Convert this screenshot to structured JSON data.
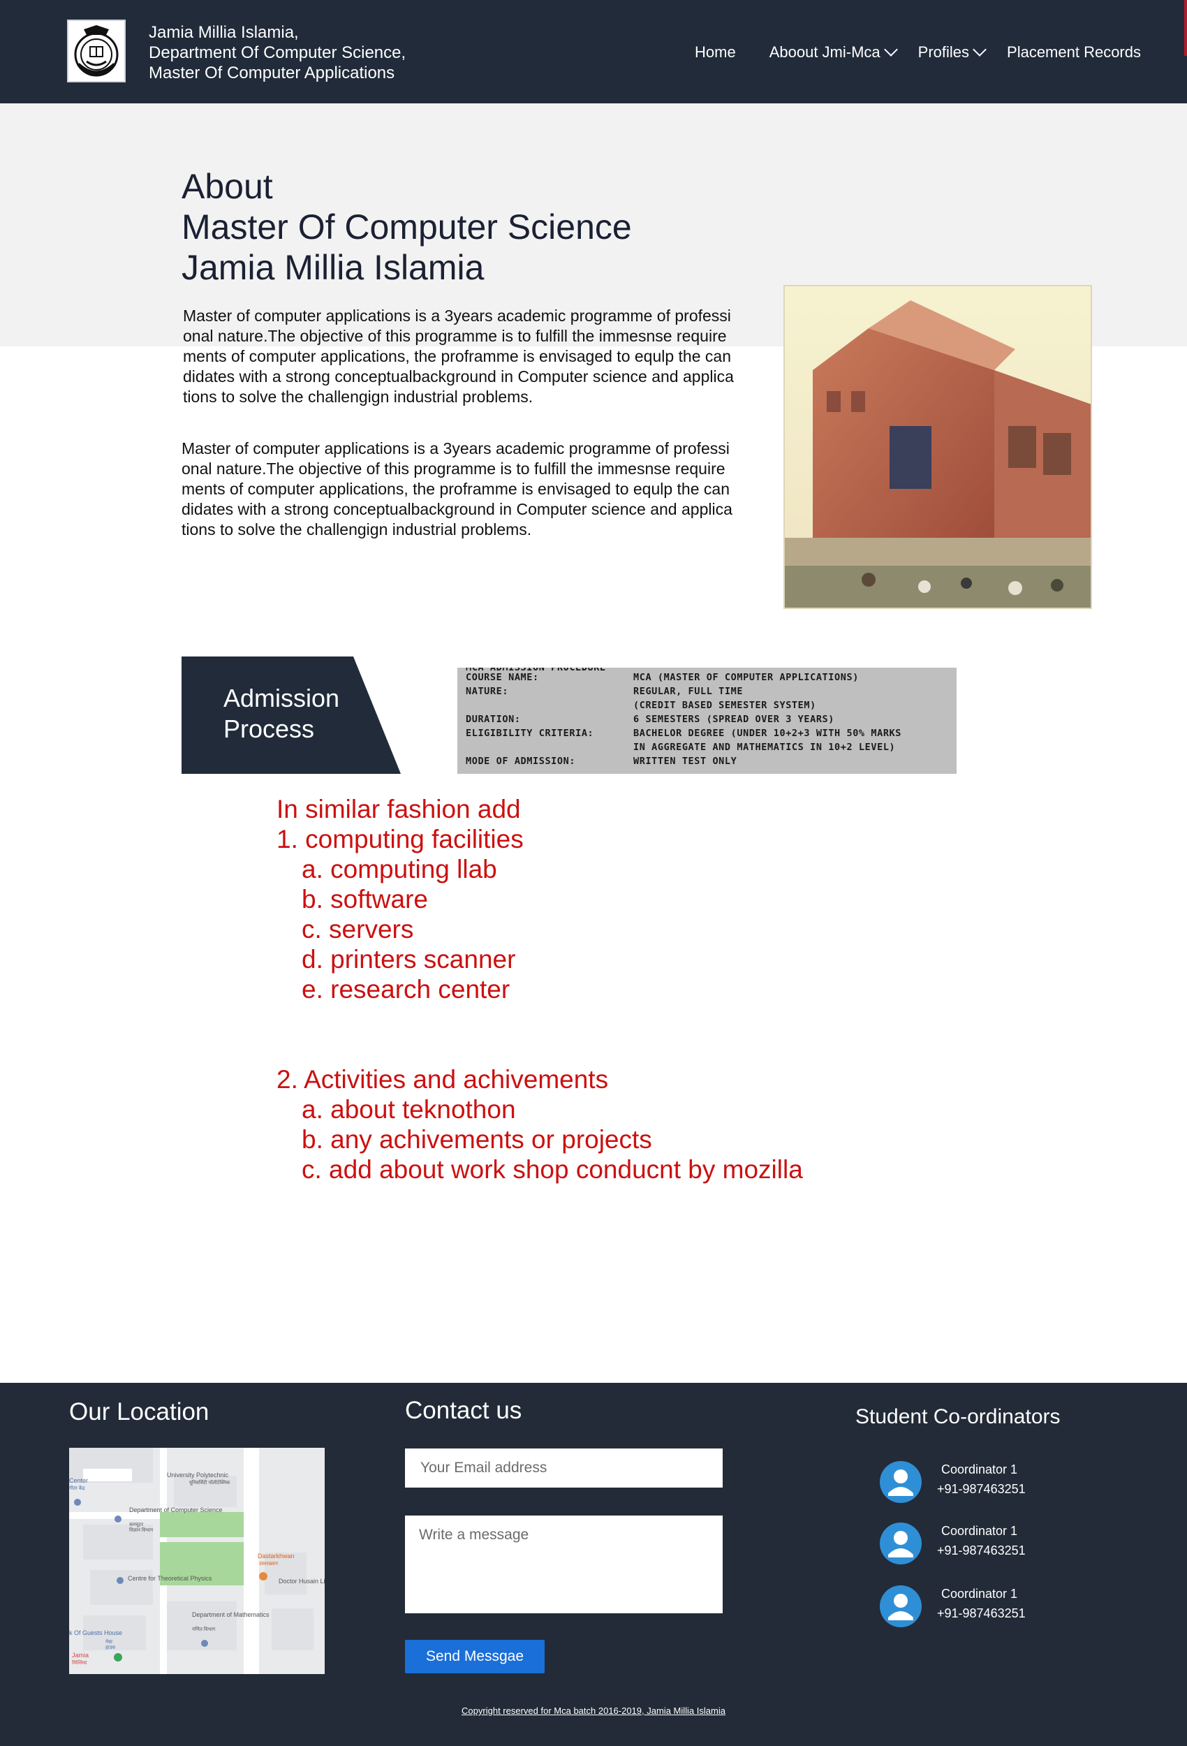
{
  "header": {
    "brand_line1": "Jamia Millia Islamia,",
    "brand_line2": "Department Of Computer Science,",
    "brand_line3": "Master Of Computer Applications",
    "logo_icon": "university-seal-icon",
    "nav": {
      "home": "Home",
      "about": "Aboout Jmi-Mca",
      "profiles": "Profiles",
      "placement": "Placement Records"
    }
  },
  "about": {
    "title_line1": "About",
    "title_line2": "Master Of Computer Science",
    "title_line3": "Jamia Millia Islamia",
    "paragraph1": "Master of computer applications is a 3years academic programme of professional nature.The objective of this programme is to fulfill the immesnse requirements of computer applications, the proframme is envisaged to equlp the candidates with a strong conceptualbackground in Computer science and applications to solve the challengign industrial problems.",
    "paragraph2": "Master of computer applications is a 3years academic programme of professional nature.The objective of this programme is to fulfill the immesnse requirements of computer applications, the proframme is envisaged to equlp the candidates with a strong conceptualbackground in Computer science and applications to solve the challengign industrial problems."
  },
  "admission": {
    "banner_line1": "Admission",
    "banner_line2": "Process",
    "table": {
      "heading": "MCA ADMISSION PROCEDURE",
      "rows": [
        {
          "key": "COURSE NAME:",
          "value": "MCA (MASTER OF COMPUTER APPLICATIONS)"
        },
        {
          "key": "NATURE:",
          "value": "REGULAR, FULL TIME"
        },
        {
          "key": "",
          "value": "(CREDIT BASED SEMESTER SYSTEM)"
        },
        {
          "key": "DURATION:",
          "value": "6 SEMESTERS (SPREAD OVER 3 YEARS)"
        },
        {
          "key": "ELIGIBILITY CRITERIA:",
          "value": "BACHELOR DEGREE (UNDER 10+2+3 WITH 50% MARKS"
        },
        {
          "key": "",
          "value": "IN AGGREGATE AND MATHEMATICS IN 10+2 LEVEL)"
        },
        {
          "key": "MODE OF ADMISSION:",
          "value": "WRITTEN TEST ONLY"
        }
      ]
    }
  },
  "notes": {
    "l1": "In similar fashion add",
    "l2": "1. computing facilities",
    "l3": "a. computing llab",
    "l4": "b. software",
    "l5": "c. servers",
    "l6": "d. printers scanner",
    "l7": "e. research center",
    "l8": "2. Activities and achivements",
    "l9": "a. about teknothon",
    "l10": "b. any achivements or projects",
    "l11": "c. add about work shop conducnt by mozilla"
  },
  "footer": {
    "location_title": "Our Location",
    "contact_title": "Contact us",
    "coordinators_title": "Student Co-ordinators",
    "email_placeholder": "Your Email address",
    "message_placeholder": "Write a message",
    "send_label": "Send Messgae",
    "map": {
      "labels": {
        "center": "Center",
        "center_sub": "गीता केंद्र",
        "university_polytechnic": "University Polytechnic",
        "university_polytechnic_sub": "यूनिवर्सिटी पॉलीटेक्निक",
        "dept_cs": "Department of Computer Science",
        "dept_cs_sub1": "कम्प्यूटर",
        "dept_cs_sub2": "विज्ञान विभाग",
        "theoretical_physics": "Centre for Theoretical Physics",
        "dastarkhwan": "Dastarkhwan",
        "dastarkhwan_sub": "दस्तरख़्वान",
        "doctor_husain": "Doctor Husain Li",
        "dept_math": "Department of Mathematics",
        "dept_math_sub": "गणित विभाग",
        "guests_house": "k Of Guests House",
        "guests_house_sub1": "गेस्ट",
        "guests_house_sub2": "हाउस",
        "jamia": "Jamia",
        "jamia_sub": "मिल्लिया"
      }
    },
    "coordinators": [
      {
        "name": "Coordinator 1",
        "phone": "+91-987463251"
      },
      {
        "name": "Coordinator 1",
        "phone": "+91-987463251"
      },
      {
        "name": "Coordinator 1",
        "phone": "+91-987463251"
      }
    ],
    "copyright": "Copyright reserved for Mca batch 2016-2019, Jamia Millia Islamia"
  },
  "colors": {
    "header_bg": "#212b3a",
    "footer_bg": "#222b37",
    "notes_red": "#cc1010",
    "button_blue": "#1a6fd8",
    "avatar_blue": "#2f8fd6"
  }
}
